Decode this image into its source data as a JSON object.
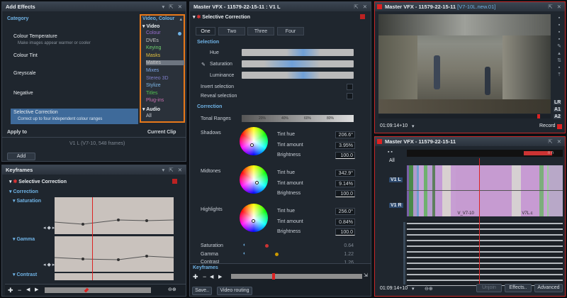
{
  "add_effects": {
    "title": "Add Effects",
    "category_label": "Category",
    "category_value": "Video, Colour",
    "items": [
      {
        "name": "Colour Temperature",
        "desc": "Make images appear warmer or cooler"
      },
      {
        "name": "Colour Tint",
        "desc": ""
      },
      {
        "name": "Greyscale",
        "desc": ""
      },
      {
        "name": "Negative",
        "desc": ""
      },
      {
        "name": "Selective Correction",
        "desc": "Correct up to four independent colour ranges"
      }
    ],
    "apply_to_label": "Apply to",
    "apply_to_value": "Current Clip",
    "clip_info": "V1 L (V7-10, 548 frames)",
    "add_button": "Add",
    "dropdown": {
      "video_header": "Video",
      "video_items": [
        "Colour",
        "DVEs",
        "Keying",
        "Masks",
        "Mattes",
        "Mixes",
        "Stereo 3D",
        "Stylize",
        "Titles",
        "Plug-ins"
      ],
      "video_colors": [
        "#9a6fd0",
        "#c8c8c8",
        "#6fd06f",
        "#e0c040",
        "#c8c8c8",
        "#7ea8e8",
        "#7e7ec8",
        "#7eb8e8",
        "#50c050",
        "#c86fb0"
      ],
      "audio_header": "Audio",
      "audio_items": [
        "All"
      ]
    }
  },
  "keyframes": {
    "title": "Keyframes",
    "effect": "Selective Correction",
    "groups": [
      "Correction",
      "Saturation",
      "Gamma",
      "Contrast"
    ]
  },
  "master_center": {
    "title": "Master VFX - 11579-22-15-11 : V1 L",
    "effect": "Selective Correction",
    "tabs": [
      "One",
      "Two",
      "Three",
      "Four"
    ],
    "selection_label": "Selection",
    "sliders": [
      "Hue",
      "Saturation",
      "Luminance"
    ],
    "invert": "Invert selection",
    "reveal": "Reveal selection",
    "correction_label": "Correction",
    "tonal_label": "Tonal Ranges",
    "tonal_ticks": [
      "20%",
      "40%",
      "60%",
      "80%"
    ],
    "groups": [
      {
        "name": "Shadows",
        "hue": "206.6°",
        "amount": "3.95%",
        "brightness": "100.0"
      },
      {
        "name": "Midtones",
        "hue": "342.9°",
        "amount": "9.14%",
        "brightness": "100.0"
      },
      {
        "name": "Highlights",
        "hue": "256.0°",
        "amount": "0.84%",
        "brightness": "100.0"
      }
    ],
    "tint_hue": "Tint hue",
    "tint_amount": "Tint amount",
    "brightness": "Brightness",
    "bottom_rows": [
      {
        "name": "Saturation",
        "value": "0.64"
      },
      {
        "name": "Gamma",
        "value": "1.22"
      },
      {
        "name": "Contrast",
        "value": "1.26"
      }
    ],
    "keyframes_label": "Keyframes",
    "save_button": "Save..",
    "routing_button": "Video routing"
  },
  "viewer": {
    "title": "Master VFX - 11579-22-15-11",
    "subtitle": "[V7-10L.new.01]",
    "timecode": "01:09:14+10",
    "record": "Record",
    "side": [
      "LR",
      "A1",
      "A2"
    ]
  },
  "timeline": {
    "title": "Master VFX - 11579-22-15-11",
    "all_label": "All",
    "tracks": [
      "V1 L",
      "V1 R"
    ],
    "clip_labels": [
      "V_V7-10",
      "V7L.c"
    ],
    "timecode": "01:09:14+10",
    "unjoin": "Unjoin",
    "effects": "Effects..",
    "advanced": "Advanced"
  }
}
